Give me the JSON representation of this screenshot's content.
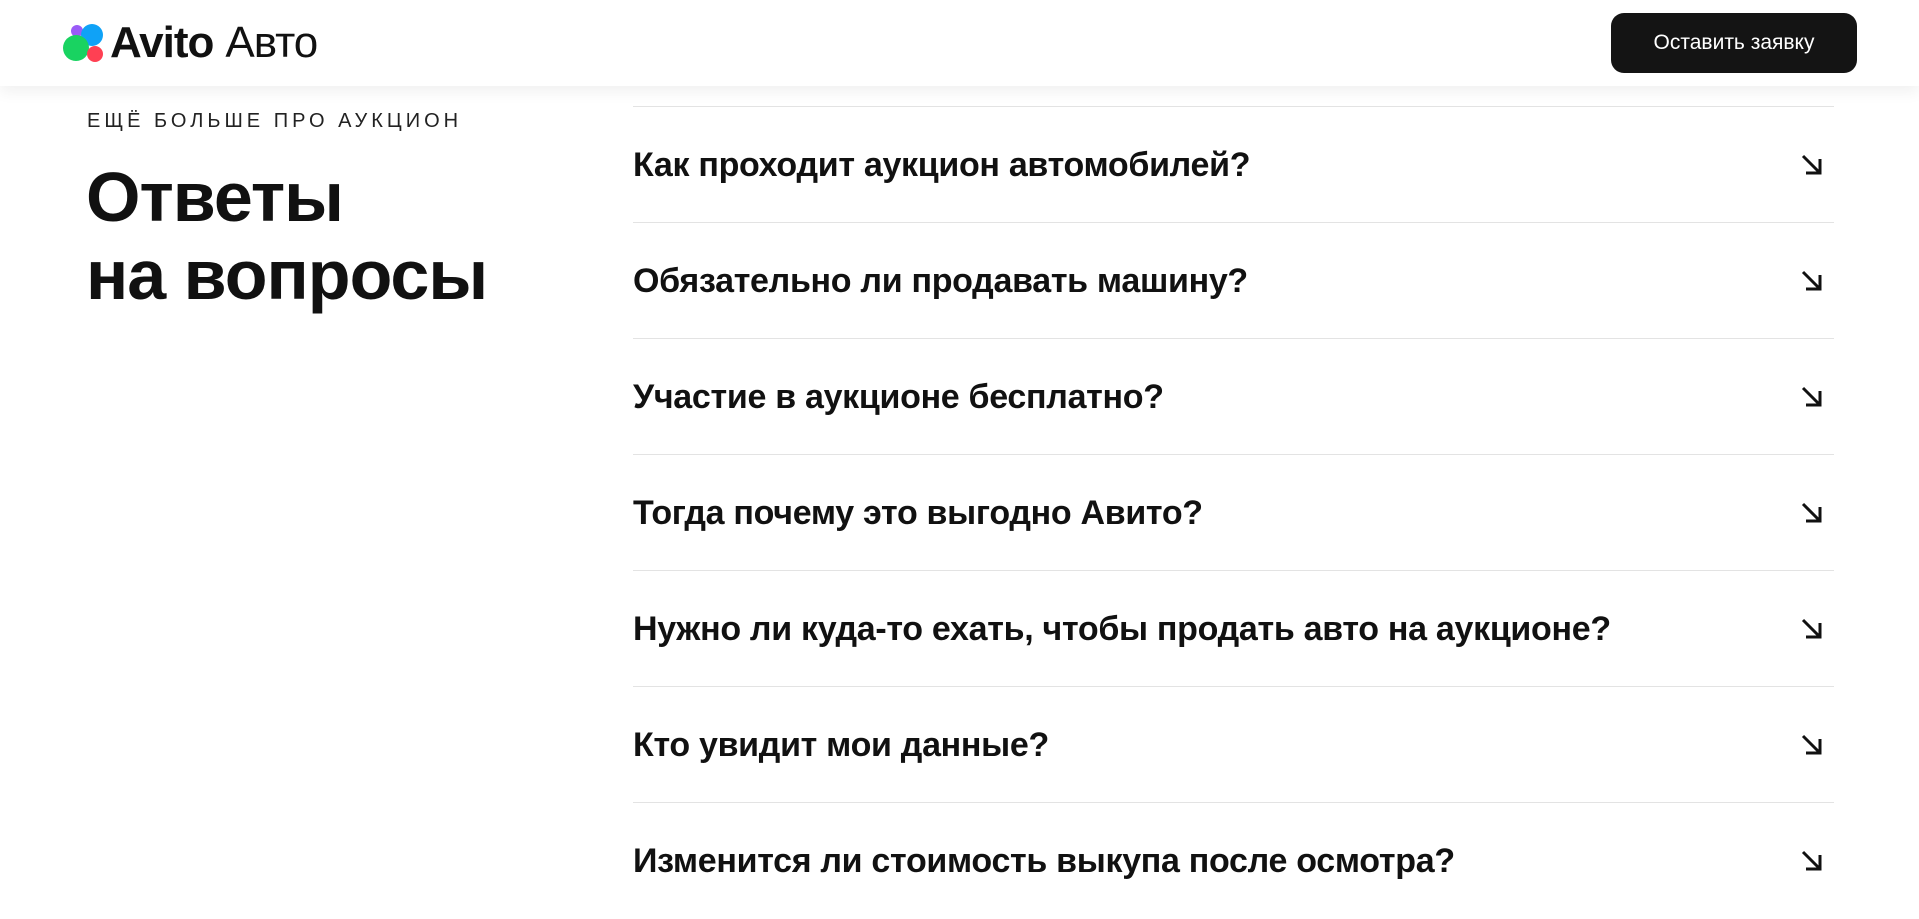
{
  "header": {
    "logo": {
      "word1": "Avito",
      "word2": "Авто",
      "dot_colors": {
        "green": "#19d361",
        "blue": "#0fa2f7",
        "purple": "#9a5bf7",
        "red": "#ff4053"
      }
    },
    "cta_label": "Оставить заявку"
  },
  "faq": {
    "eyebrow": "ЕЩЁ БОЛЬШЕ ПРО АУКЦИОН",
    "title_line1": "Ответы",
    "title_line2": "на вопросы",
    "expand_icon": "arrow-down-right-icon",
    "items": [
      {
        "question": "Как проходит аукцион автомобилей?"
      },
      {
        "question": "Обязательно ли продавать машину?"
      },
      {
        "question": "Участие в аукционе бесплатно?"
      },
      {
        "question": "Тогда почему это выгодно Авито?"
      },
      {
        "question": "Нужно ли куда-то ехать, чтобы продать авто на аукционе?"
      },
      {
        "question": "Кто увидит мои данные?"
      },
      {
        "question": "Изменится ли стоимость выкупа после осмотра?"
      }
    ]
  }
}
